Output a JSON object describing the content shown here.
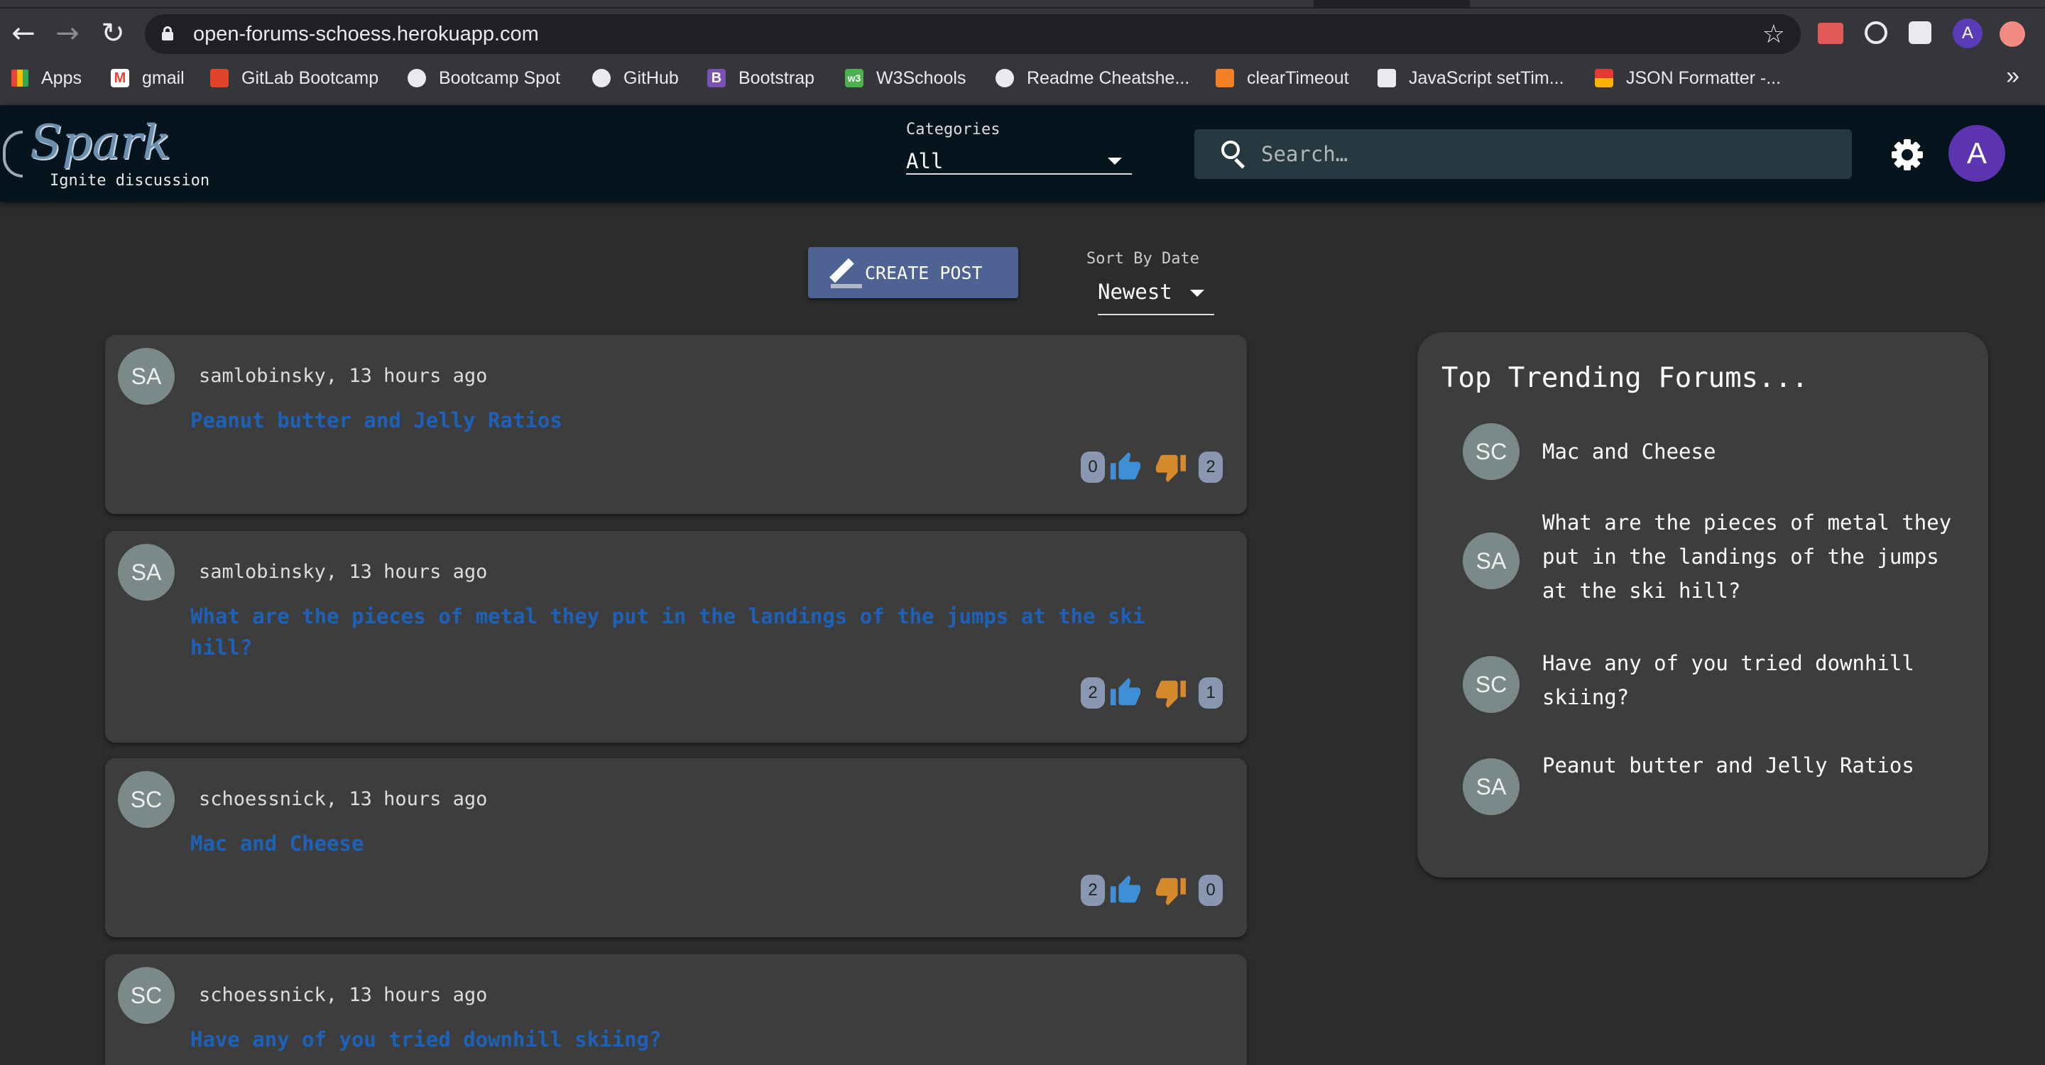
{
  "browser": {
    "url": "open-forums-schoess.herokuapp.com",
    "profile_initial": "A",
    "bookmarks": [
      {
        "label": "Apps",
        "icon": "apps-grid-icon"
      },
      {
        "label": "gmail",
        "icon": "gmail-icon"
      },
      {
        "label": "GitLab Bootcamp",
        "icon": "gitlab-icon"
      },
      {
        "label": "Bootcamp Spot",
        "icon": "globe-icon"
      },
      {
        "label": "GitHub",
        "icon": "github-icon"
      },
      {
        "label": "Bootstrap",
        "icon": "bootstrap-icon"
      },
      {
        "label": "W3Schools",
        "icon": "w3schools-icon"
      },
      {
        "label": "Readme Cheatshe...",
        "icon": "github-icon"
      },
      {
        "label": "clearTimeout",
        "icon": "stackoverflow-icon"
      },
      {
        "label": "JavaScript setTim...",
        "icon": "html5-icon"
      },
      {
        "label": "JSON Formatter -...",
        "icon": "json-formatter-icon"
      }
    ],
    "more": "»"
  },
  "header": {
    "logo_text": "Spark",
    "tagline": "Ignite discussion",
    "categories_label": "Categories",
    "categories_value": "All",
    "search_placeholder": "Search…",
    "user_initial": "A"
  },
  "controls": {
    "create_label": "CREATE POST",
    "sort_label": "Sort By Date",
    "sort_value": "Newest"
  },
  "posts": [
    {
      "initials": "SA",
      "meta": "samlobinsky, 13 hours ago",
      "title": "Peanut butter and Jelly Ratios",
      "up": "0",
      "down": "2"
    },
    {
      "initials": "SA",
      "meta": "samlobinsky, 13 hours ago",
      "title": "What are the pieces of metal they put in the landings of the jumps at the ski hill?",
      "up": "2",
      "down": "1"
    },
    {
      "initials": "SC",
      "meta": "schoessnick, 13 hours ago",
      "title": "Mac and Cheese",
      "up": "2",
      "down": "0"
    },
    {
      "initials": "SC",
      "meta": "schoessnick, 13 hours ago",
      "title": "Have any of you tried downhill skiing?",
      "up": "",
      "down": ""
    }
  ],
  "trending": {
    "title": "Top Trending Forums...",
    "items": [
      {
        "initials": "SC",
        "text": "Mac and Cheese"
      },
      {
        "initials": "SA",
        "text": "What are the pieces of metal they put in the landings of the jumps at the ski hill?"
      },
      {
        "initials": "SC",
        "text": "Have any of you tried downhill skiing?"
      },
      {
        "initials": "SA",
        "text": "Peanut butter and Jelly Ratios"
      }
    ]
  },
  "colors": {
    "header_bg": "#06141d",
    "page_bg": "#2c2c2c",
    "card_bg": "#3d3d3d",
    "link": "#1d62b8",
    "thumb_up": "#3f8fd6",
    "thumb_down": "#d58a2b",
    "accent": "#4e6394"
  }
}
